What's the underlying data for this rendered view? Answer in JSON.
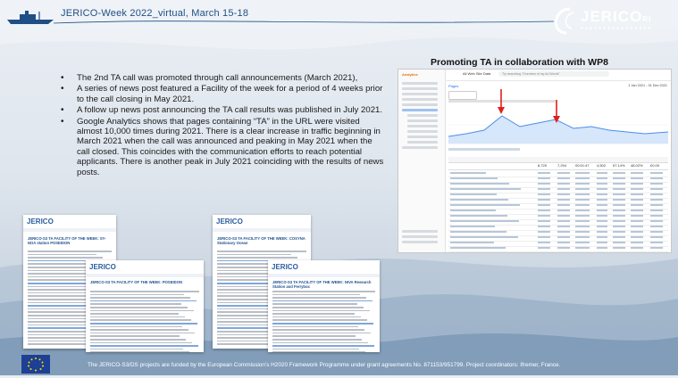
{
  "header": {
    "title": "JERICO-Week 2022_virtual, March 15-18"
  },
  "logo": {
    "text": "JERICO",
    "suffix": "RI"
  },
  "section_title": "Promoting TA in collaboration with WP8",
  "bullets": [
    "The 2nd TA call was promoted through call announcements (March 2021),",
    "A series of news post featured a Facility of the week for a period of 4 weeks prior to the call closing in May 2021.",
    "A follow up news post announcing the TA call results was published in July 2021.",
    "Google Analytics shows that pages containing “TA” in the URL were visited almost 10,000 times during 2021. There is a clear increase in traffic beginning in March 2021 when the call was announced and peaking in May 2021 when the call closed. This coincides with the communication efforts to reach potential applicants. There is another peak in July 2021 coinciding with the results of news posts."
  ],
  "ga": {
    "app_name": "Analytics",
    "account": "All Web Site Data",
    "search_placeholder": "Try searching \"Overview of my Ad Words\"",
    "report": "Pages",
    "date_range": "1 Jan 2021 - 31 Dec 2021",
    "summary": [
      "8,729",
      "7,294",
      "00:01:47",
      "4,502",
      "57.14%",
      "48.02%",
      "£0.00"
    ]
  },
  "docs": [
    {
      "logo": "JERICO",
      "title": "JERICO-S3 TA FACILITY OF THE WEEK: SY-NOA station POSEIDON"
    },
    {
      "logo": "JERICO",
      "title": "JERICO-S3 TA FACILITY OF THE WEEK: POSEIDON"
    },
    {
      "logo": "JERICO",
      "title": "JERICO-S3 TA FACILITY OF THE WEEK: COSYNA Stationary Ocean"
    },
    {
      "logo": "JERICO",
      "title": "JERICO-S3 TA FACILITY OF THE WEEK: NIVA Research Station and Ferrybox"
    }
  ],
  "footer": {
    "text": "The JERICO-S3/DS projects are funded by the European Commission’s H2020 Framework Programme under grant agreements No. 871153/951799. Project coordinators: Ifremer, France."
  },
  "colors": {
    "header_text": "#1f4e86",
    "accent": "#1a73e8",
    "eu_blue": "#1d3f94"
  }
}
